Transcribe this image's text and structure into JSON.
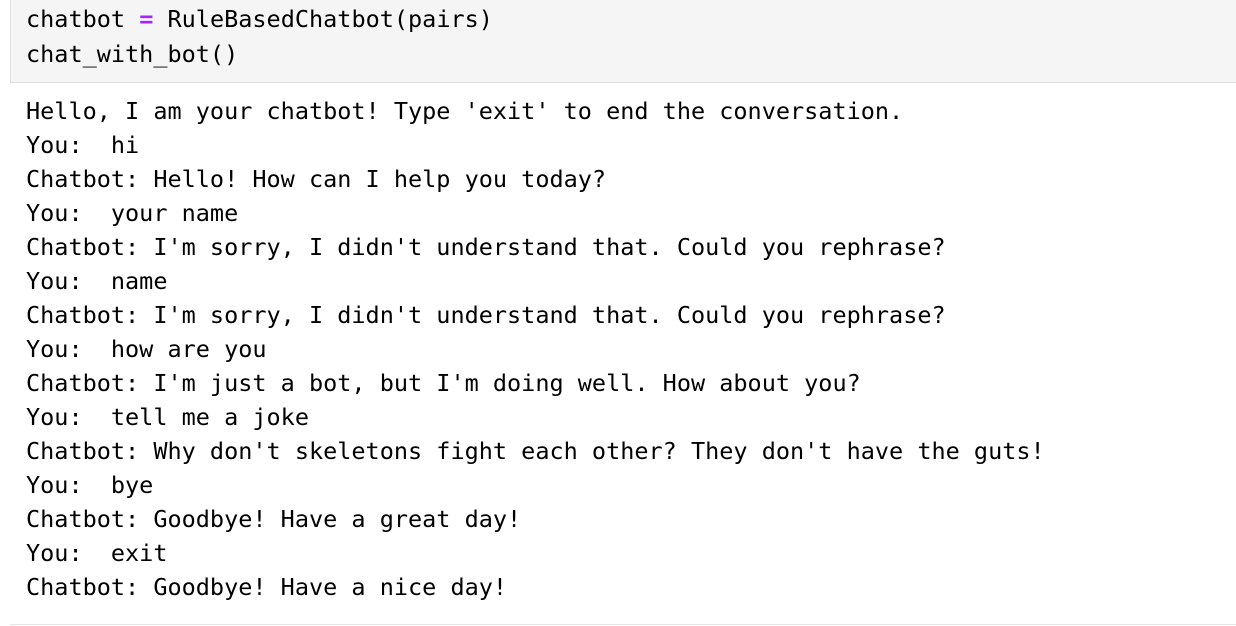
{
  "input_cell": {
    "line1_var": "chatbot",
    "line1_op": "=",
    "line1_call": "RuleBasedChatbot(pairs)",
    "line2": "chat_with_bot()"
  },
  "output": {
    "lines": [
      "Hello, I am your chatbot! Type 'exit' to end the conversation.",
      "You:  hi",
      "Chatbot: Hello! How can I help you today?",
      "You:  your name",
      "Chatbot: I'm sorry, I didn't understand that. Could you rephrase?",
      "You:  name",
      "Chatbot: I'm sorry, I didn't understand that. Could you rephrase?",
      "You:  how are you",
      "Chatbot: I'm just a bot, but I'm doing well. How about you?",
      "You:  tell me a joke",
      "Chatbot: Why don't skeletons fight each other? They don't have the guts!",
      "You:  bye",
      "Chatbot: Goodbye! Have a great day!",
      "You:  exit",
      "Chatbot: Goodbye! Have a nice day!"
    ]
  },
  "colors": {
    "cell_background": "#f5f5f5",
    "operator": "#aa22ff",
    "text": "#000000"
  }
}
